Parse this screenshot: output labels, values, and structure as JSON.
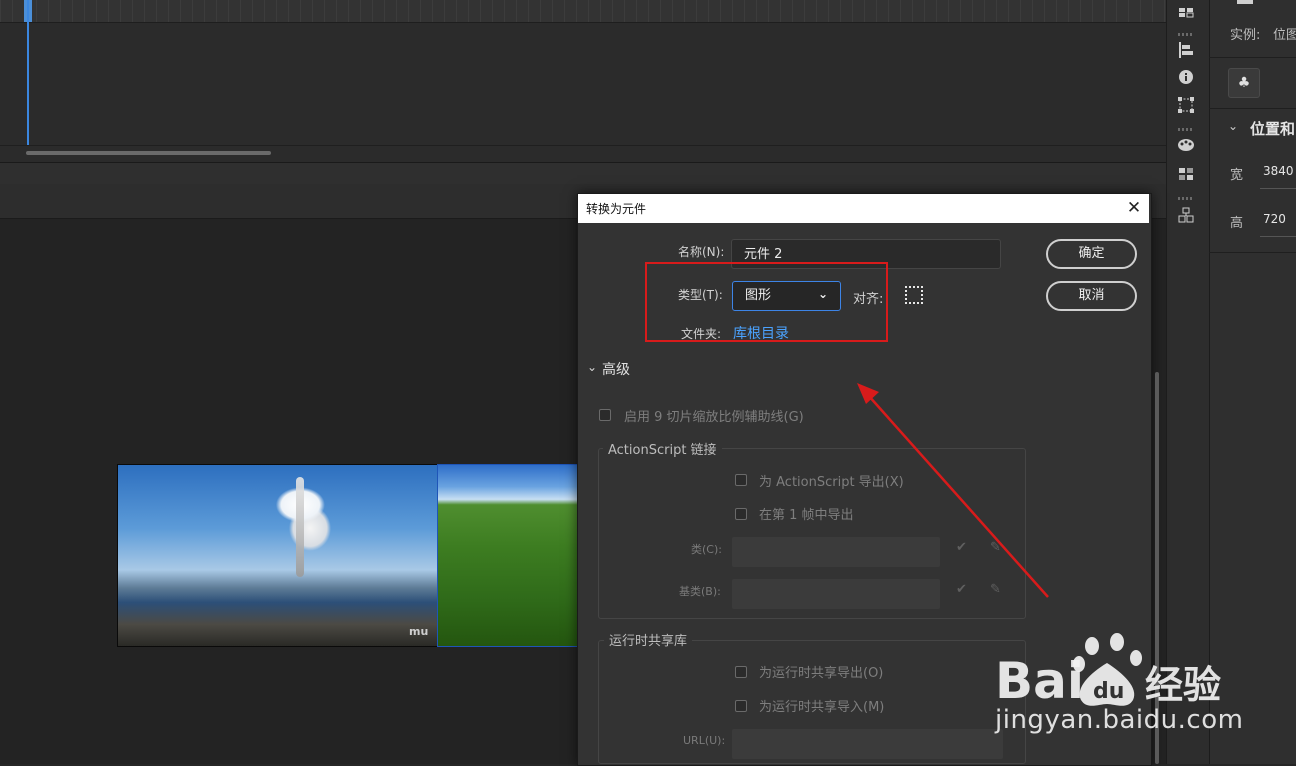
{
  "properties": {
    "instance_label": "实例:",
    "instance_value": "位图",
    "section_title": "位置和",
    "width_label": "宽",
    "width_value": "3840",
    "height_label": "高",
    "height_value": "720"
  },
  "stage": {
    "watermark": "mu"
  },
  "dialog": {
    "title": "转换为元件",
    "close_glyph": "✕",
    "name_label": "名称(N):",
    "name_value": "元件 2",
    "type_label": "类型(T):",
    "type_value": "图形",
    "align_label": "对齐:",
    "folder_label": "文件夹:",
    "folder_value": "库根目录",
    "ok_label": "确定",
    "cancel_label": "取消",
    "advanced_label": "高级",
    "nine_slice_label": "启用 9 切片缩放比例辅助线(G)",
    "actionscript_group": "ActionScript 链接",
    "export_as_label": "为 ActionScript 导出(X)",
    "export_frame1_label": "在第 1 帧中导出",
    "class_label": "类(C):",
    "base_class_label": "基类(B):",
    "runtime_group": "运行时共享库",
    "runtime_export_label": "为运行时共享导出(O)",
    "runtime_import_label": "为运行时共享导入(M)",
    "url_label": "URL(U):"
  },
  "watermark": {
    "brand": "Baidu经验",
    "url": "jingyan.baidu.com"
  },
  "colors": {
    "accent_blue": "#3d84e6",
    "link_blue": "#4ba3ff",
    "highlight_red": "#d81b1b"
  }
}
